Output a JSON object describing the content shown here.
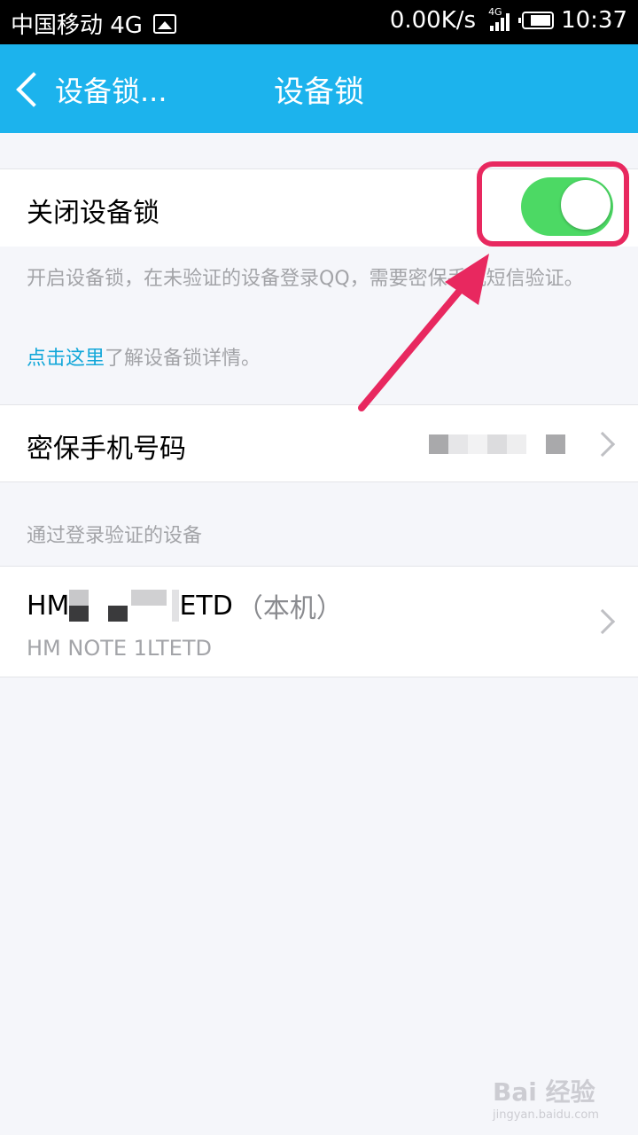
{
  "status_bar": {
    "carrier": "中国移动 4G",
    "net_speed": "0.00K/s",
    "signal_label": "4G",
    "time": "10:37"
  },
  "nav": {
    "back_label": "设备锁...",
    "title": "设备锁"
  },
  "lock_row": {
    "label": "关闭设备锁",
    "toggle_on": true,
    "toggle_color": "#4cd964"
  },
  "description": "开启设备锁，在未验证的设备登录QQ，需要密保手机短信验证。",
  "learn_more": {
    "link_text": "点击这里",
    "rest_text": "了解设备锁详情。"
  },
  "phone_row": {
    "label": "密保手机号码"
  },
  "devices_section": {
    "header": "通过登录验证的设备",
    "items": [
      {
        "name_prefix": "HM",
        "name_suffix": "ETD",
        "tag": "（本机）",
        "model": "HM NOTE 1LTETD"
      }
    ]
  },
  "watermark": {
    "brand": "Bai 经验",
    "url": "jingyan.baidu.com"
  },
  "colors": {
    "nav_bg": "#1cb3ed",
    "link": "#12a7d9",
    "highlight": "#e8285f"
  }
}
